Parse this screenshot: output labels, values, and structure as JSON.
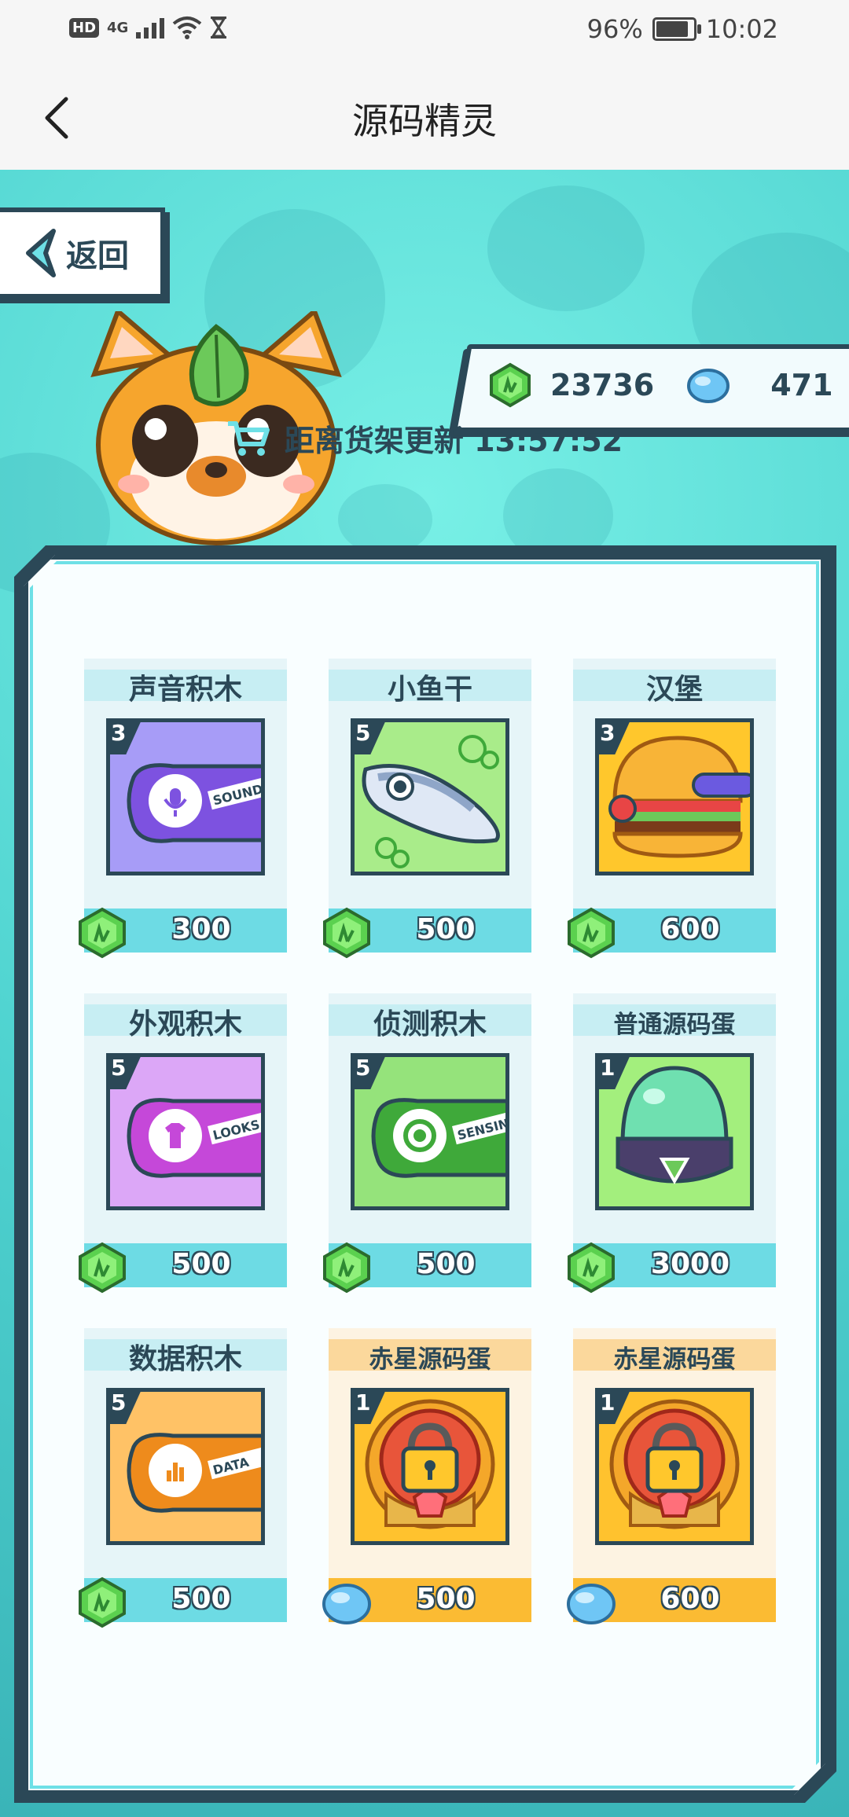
{
  "status_bar": {
    "hd": "HD",
    "network": "4G",
    "battery_percent_text": "96%",
    "battery_level": 0.96,
    "time": "10:02"
  },
  "header": {
    "title": "源码精灵",
    "back_icon": "chevron-left-icon"
  },
  "game": {
    "back_button_label": "返回",
    "gems": "23736",
    "crystals": "471",
    "timer_label": "距离货架更新 13:57:52",
    "items": [
      {
        "name": "声音积木",
        "level": "3",
        "price": "300",
        "currency": "gem",
        "theme": "sound",
        "color": "#a79cf7"
      },
      {
        "name": "小鱼干",
        "level": "5",
        "price": "500",
        "currency": "gem",
        "theme": "fish",
        "color": "#a9ec8a"
      },
      {
        "name": "汉堡",
        "level": "3",
        "price": "600",
        "currency": "gem",
        "theme": "burger",
        "color": "#ffc72c"
      },
      {
        "name": "外观积木",
        "level": "5",
        "price": "500",
        "currency": "gem",
        "theme": "looks",
        "color": "#dca7f7"
      },
      {
        "name": "侦测积木",
        "level": "5",
        "price": "500",
        "currency": "gem",
        "theme": "sensing",
        "color": "#95e37b"
      },
      {
        "name": "普通源码蛋",
        "level": "1",
        "price": "3000",
        "currency": "gem",
        "theme": "egg",
        "color": "#a3ef7d"
      },
      {
        "name": "数据积木",
        "level": "5",
        "price": "500",
        "currency": "gem",
        "theme": "data",
        "color": "#ffc266"
      },
      {
        "name": "赤星源码蛋",
        "level": "1",
        "price": "500",
        "currency": "crystal",
        "theme": "red-egg",
        "color": "#ffc22e"
      },
      {
        "name": "赤星源码蛋",
        "level": "1",
        "price": "600",
        "currency": "crystal",
        "theme": "red-egg",
        "color": "#ffc22e"
      }
    ]
  },
  "colors": {
    "accent_dark": "#2b4857",
    "teal": "#4fd3d0",
    "price_bar_blue": "#6ddbe4",
    "price_bar_orange": "#fbbb33"
  }
}
